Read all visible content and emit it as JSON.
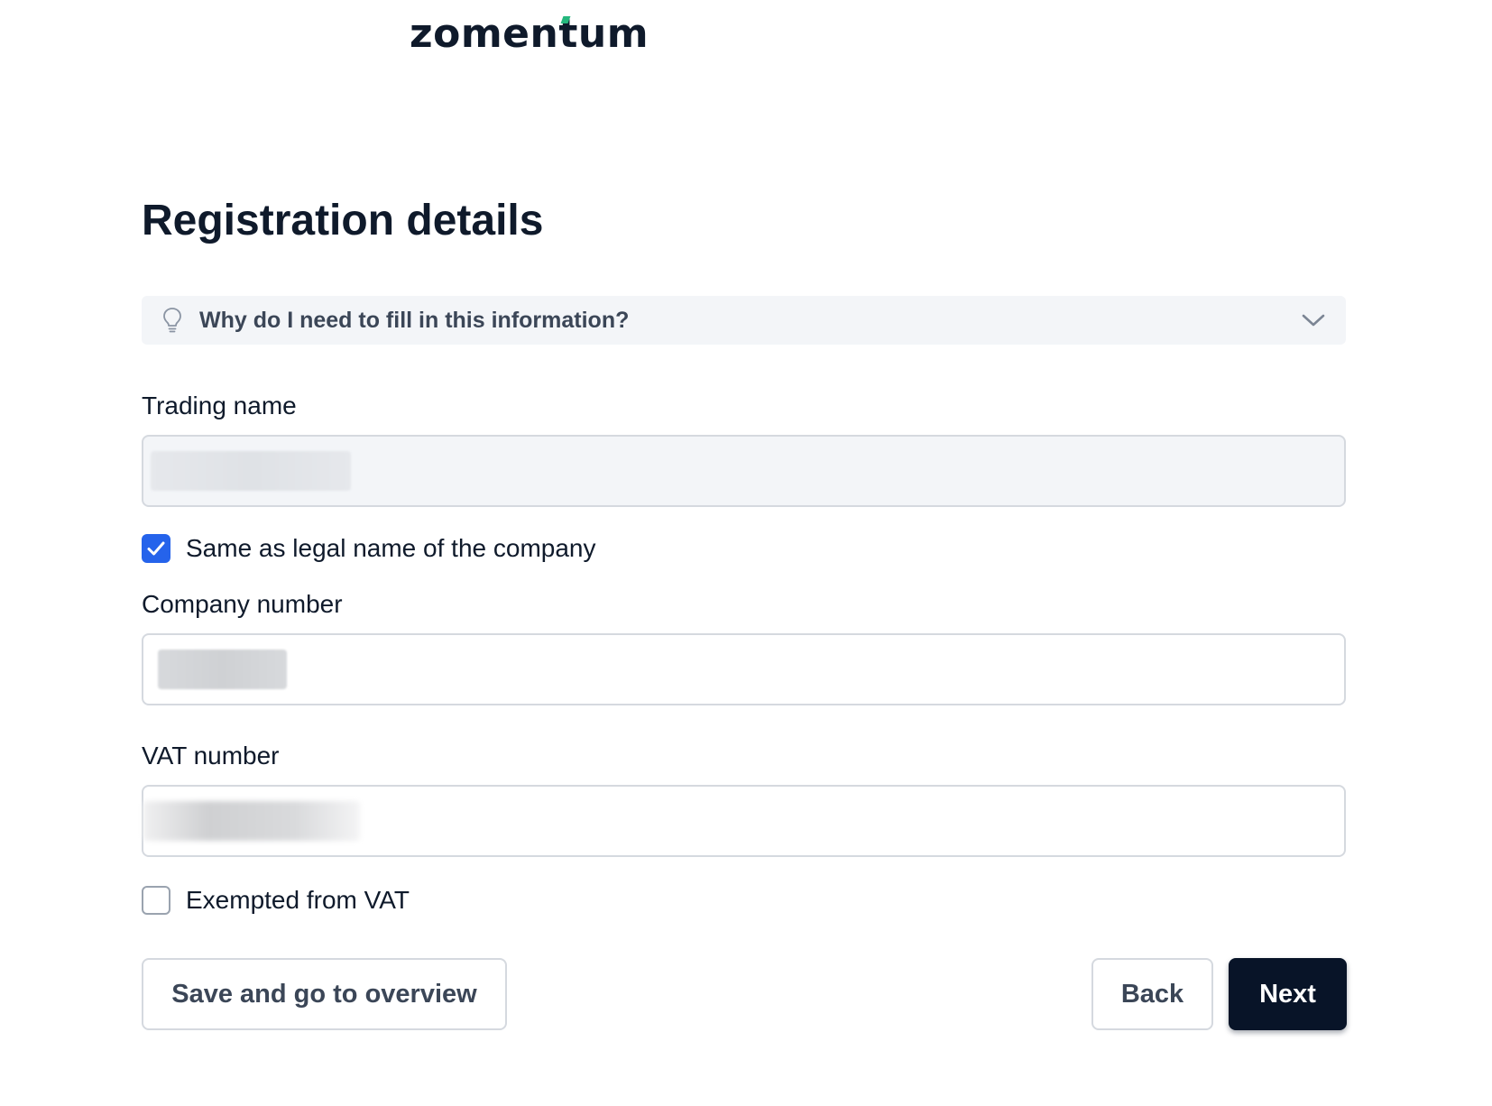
{
  "brand": {
    "logo_text": "zomentum",
    "accent_color": "#25b77d"
  },
  "form": {
    "title": "Registration details",
    "info": {
      "text": "Why do I need to fill in this information?",
      "icon": "lightbulb-icon",
      "expand_icon": "chevron-down-icon"
    },
    "trading_name": {
      "label": "Trading name",
      "value_redacted": true,
      "disabled": true
    },
    "same_as_legal": {
      "label": "Same as legal name of the company",
      "checked": true
    },
    "company_number": {
      "label": "Company number",
      "value_redacted": true
    },
    "vat_number": {
      "label": "VAT number",
      "value_redacted": true
    },
    "vat_exempt": {
      "label": "Exempted from VAT",
      "checked": false
    }
  },
  "actions": {
    "save_label": "Save and go to overview",
    "back_label": "Back",
    "next_label": "Next"
  },
  "colors": {
    "primary_dark": "#081428",
    "checkbox_blue": "#2563eb",
    "info_bg": "#f3f5f8"
  }
}
